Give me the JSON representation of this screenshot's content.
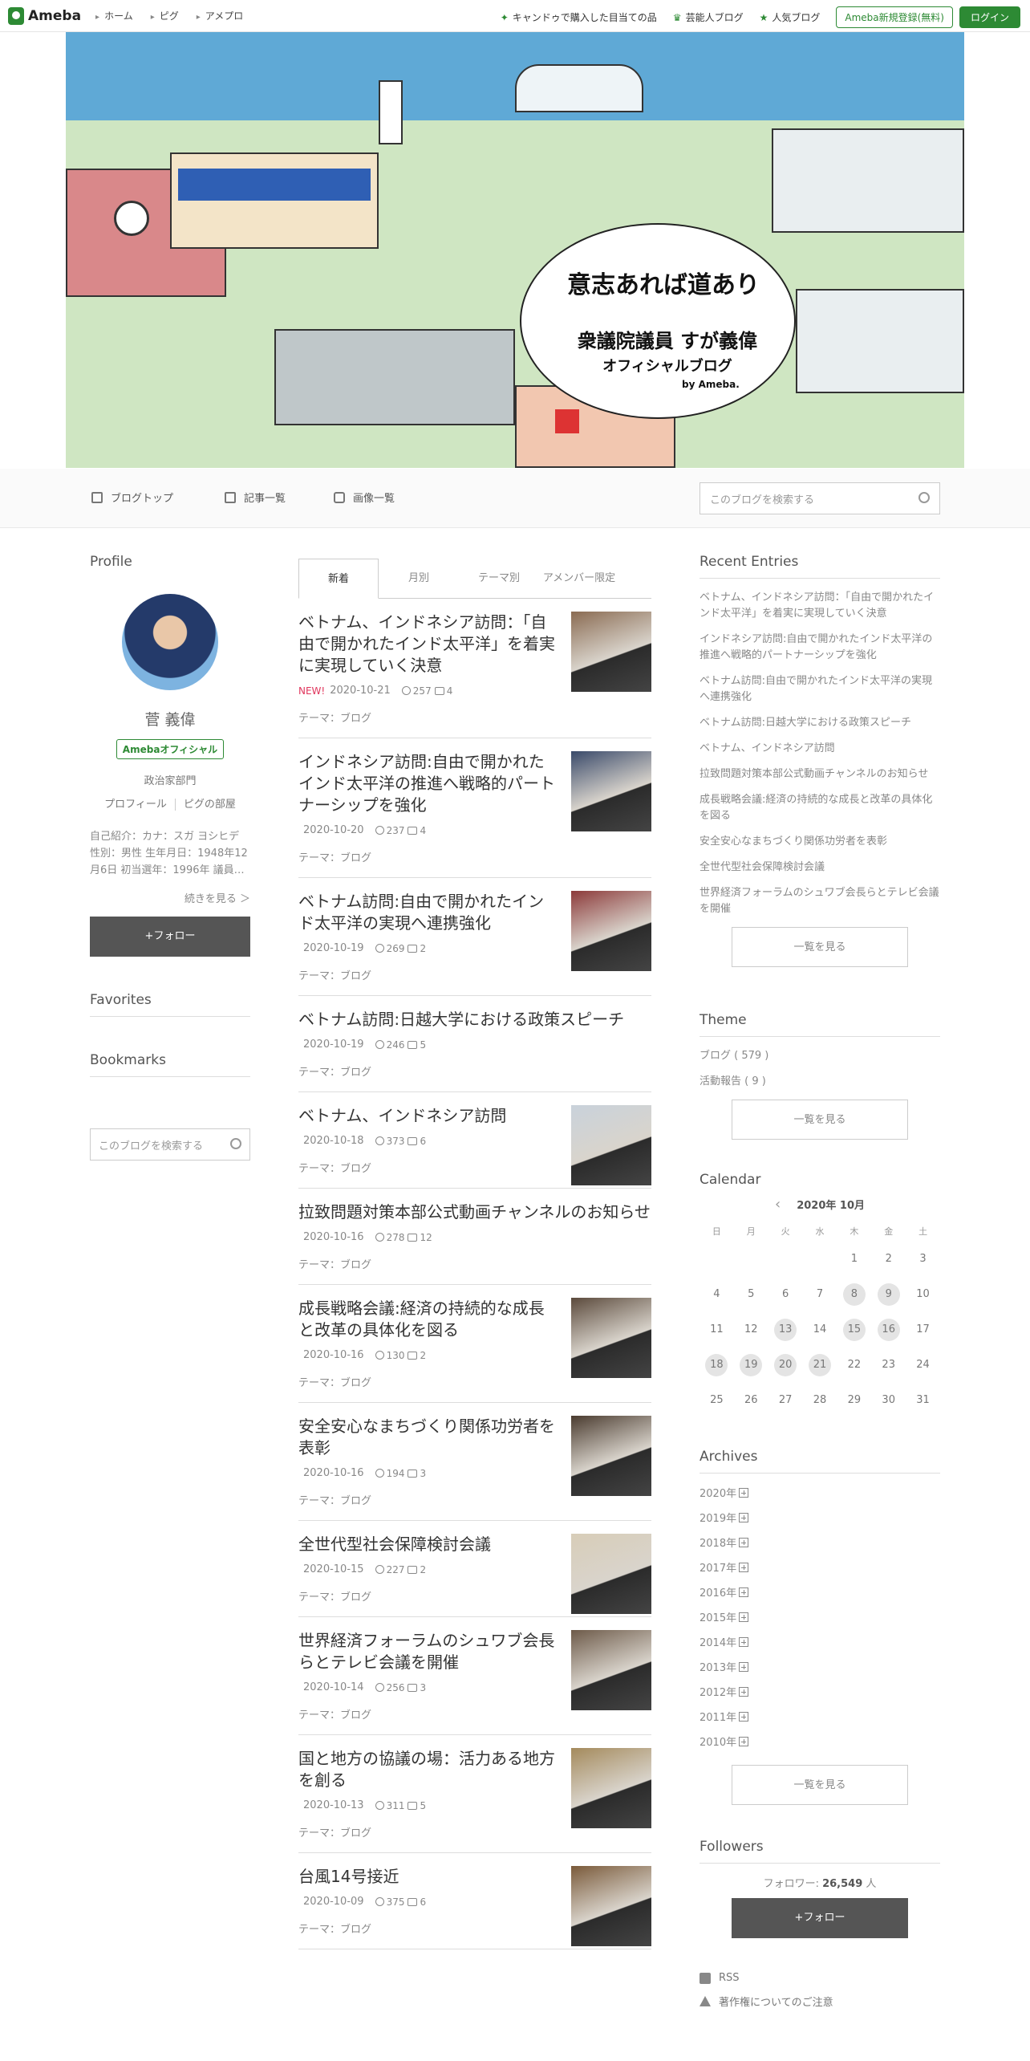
{
  "topbar": {
    "logo": "Ameba",
    "nav": [
      "ホーム",
      "ピグ",
      "アメプロ"
    ],
    "promos": [
      "キャンドゥで購入した目当ての品",
      "芸能人ブログ",
      "人気ブログ"
    ],
    "register": "Ameba新規登録(無料)",
    "login": "ログイン"
  },
  "hero": {
    "slogan": "意志あれば道あり",
    "name": "衆議院議員 すが義偉",
    "sub": "オフィシャルブログ",
    "by": "by Ameba."
  },
  "subnav": {
    "items": [
      "ブログトップ",
      "記事一覧",
      "画像一覧"
    ],
    "search_placeholder": "このブログを検索する"
  },
  "profile": {
    "heading": "Profile",
    "name": "菅 義偉",
    "badge": "Amebaオフィシャル",
    "dept": "政治家部門",
    "link_profile": "プロフィール",
    "link_room": "ピグの部屋",
    "intro": "自己紹介：カナ：スガ ヨシヒデ 性別：男性 生年月日：1948年12月6日 初当選年：1996年 議員…",
    "more": "続きを見る ＞",
    "follow": "+フォロー"
  },
  "left_sections": {
    "favorites": "Favorites",
    "bookmarks": "Bookmarks",
    "search_placeholder": "このブログを検索する"
  },
  "tabs": [
    "新着",
    "月別",
    "テーマ別",
    "アメンバー限定"
  ],
  "entries": [
    {
      "title": "ベトナム、インドネシア訪問：「自由で開かれたインド太平洋」を着実に実現していく決意",
      "new": "NEW!",
      "date": "2020-10-21",
      "likes": "257",
      "comments": "4",
      "theme": "テーマ：ブログ"
    },
    {
      "title": "インドネシア訪問:自由で開かれたインド太平洋の推進へ戦略的パートナーシップを強化",
      "new": "",
      "date": "2020-10-20",
      "likes": "237",
      "comments": "4",
      "theme": "テーマ：ブログ"
    },
    {
      "title": "ベトナム訪問:自由で開かれたインド太平洋の実現へ連携強化",
      "new": "",
      "date": "2020-10-19",
      "likes": "269",
      "comments": "2",
      "theme": "テーマ：ブログ"
    },
    {
      "title": "ベトナム訪問:日越大学における政策スピーチ",
      "new": "",
      "date": "2020-10-19",
      "likes": "246",
      "comments": "5",
      "theme": "テーマ：ブログ"
    },
    {
      "title": "ベトナム、インドネシア訪問",
      "new": "",
      "date": "2020-10-18",
      "likes": "373",
      "comments": "6",
      "theme": "テーマ：ブログ"
    },
    {
      "title": "拉致問題対策本部公式動画チャンネルのお知らせ",
      "new": "",
      "date": "2020-10-16",
      "likes": "278",
      "comments": "12",
      "theme": "テーマ：ブログ"
    },
    {
      "title": "成長戦略会議:経済の持続的な成長と改革の具体化を図る",
      "new": "",
      "date": "2020-10-16",
      "likes": "130",
      "comments": "2",
      "theme": "テーマ：ブログ"
    },
    {
      "title": "安全安心なまちづくり関係功労者を表彰",
      "new": "",
      "date": "2020-10-16",
      "likes": "194",
      "comments": "3",
      "theme": "テーマ：ブログ"
    },
    {
      "title": "全世代型社会保障検討会議",
      "new": "",
      "date": "2020-10-15",
      "likes": "227",
      "comments": "2",
      "theme": "テーマ：ブログ"
    },
    {
      "title": "世界経済フォーラムのシュワブ会長らとテレビ会議を開催",
      "new": "",
      "date": "2020-10-14",
      "likes": "256",
      "comments": "3",
      "theme": "テーマ：ブログ"
    },
    {
      "title": "国と地方の協議の場：活力ある地方を創る",
      "new": "",
      "date": "2020-10-13",
      "likes": "311",
      "comments": "5",
      "theme": "テーマ：ブログ"
    },
    {
      "title": "台風14号接近",
      "new": "",
      "date": "2020-10-09",
      "likes": "375",
      "comments": "6",
      "theme": "テーマ：ブログ"
    }
  ],
  "recent": {
    "heading": "Recent Entries",
    "items": [
      "ベトナム、インドネシア訪問：「自由で開かれたインド太平洋」を着実に実現していく決意",
      "インドネシア訪問:自由で開かれたインド太平洋の推進へ戦略的パートナーシップを強化",
      "ベトナム訪問:自由で開かれたインド太平洋の実現へ連携強化",
      "ベトナム訪問:日越大学における政策スピーチ",
      "ベトナム、インドネシア訪問",
      "拉致問題対策本部公式動画チャンネルのお知らせ",
      "成長戦略会議:経済の持続的な成長と改革の具体化を図る",
      "安全安心なまちづくり関係功労者を表彰",
      "全世代型社会保障検討会議",
      "世界経済フォーラムのシュワブ会長らとテレビ会議を開催"
    ],
    "button": "一覧を見る"
  },
  "theme": {
    "heading": "Theme",
    "items": [
      "ブログ ( 579 )",
      "活動報告 ( 9 )"
    ],
    "button": "一覧を見る"
  },
  "calendar": {
    "heading": "Calendar",
    "prev": "‹",
    "month": "2020年 10月",
    "dow": [
      "日",
      "月",
      "火",
      "水",
      "木",
      "金",
      "土"
    ],
    "days": [
      "",
      "",
      "",
      "",
      "1",
      "2",
      "3",
      "4",
      "5",
      "6",
      "7",
      "8",
      "9",
      "10",
      "11",
      "12",
      "13",
      "14",
      "15",
      "16",
      "17",
      "18",
      "19",
      "20",
      "21",
      "22",
      "23",
      "24",
      "25",
      "26",
      "27",
      "28",
      "29",
      "30",
      "31"
    ],
    "highlighted": [
      "8",
      "9",
      "13",
      "15",
      "16",
      "18",
      "19",
      "20",
      "21"
    ]
  },
  "archives": {
    "heading": "Archives",
    "years": [
      "2020年",
      "2019年",
      "2018年",
      "2017年",
      "2016年",
      "2015年",
      "2014年",
      "2013年",
      "2012年",
      "2011年",
      "2010年"
    ],
    "button": "一覧を見る"
  },
  "followers": {
    "heading": "Followers",
    "label": "フォロワー:",
    "count": "26,549",
    "unit": "人",
    "button": "+フォロー"
  },
  "footer_links": [
    "RSS",
    "著作権についてのご注意"
  ],
  "colors": {
    "brand": "#2d8a34",
    "new": "#e0355c",
    "dark_button": "#555555"
  }
}
